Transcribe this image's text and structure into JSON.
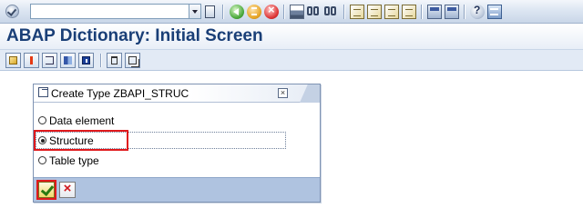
{
  "toolbar": {
    "command_field_value": "",
    "icons": [
      "enter-icon",
      "save-icon",
      "back-icon",
      "exit-icon",
      "cancel-icon",
      "print-icon",
      "find-icon",
      "find-next-icon",
      "first-page-icon",
      "previous-page-icon",
      "next-page-icon",
      "last-page-icon",
      "new-session-icon",
      "shortcut-icon",
      "help-icon",
      "layout-menu-icon"
    ]
  },
  "screen": {
    "title": "ABAP Dictionary: Initial Screen"
  },
  "app_toolbar": {
    "icons": [
      "other-object-icon",
      "check-icon",
      "where-used-icon",
      "navigate-icon",
      "display-object-list-icon",
      "delete-icon",
      "copy-icon"
    ]
  },
  "dialog": {
    "title": "Create Type ZBAPI_STRUC",
    "options": [
      {
        "label": "Data element",
        "selected": false
      },
      {
        "label": "Structure",
        "selected": true
      },
      {
        "label": "Table type",
        "selected": false
      }
    ],
    "buttons": [
      "continue-check-icon",
      "cancel-x-icon"
    ]
  },
  "colors": {
    "title": "#1a3f77",
    "highlight": "#e0191c",
    "footer": "#afc3e0"
  }
}
